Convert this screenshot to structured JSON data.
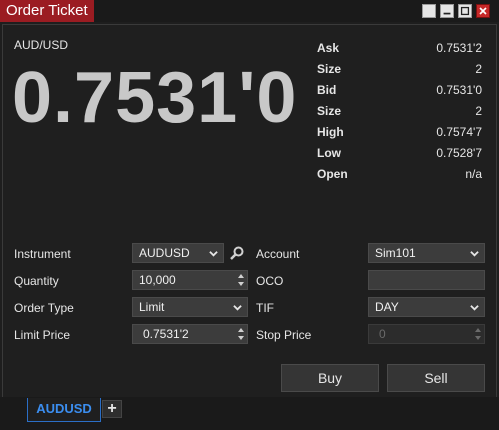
{
  "window": {
    "title": "Order Ticket"
  },
  "quote": {
    "instrument": "AUD/USD",
    "last_price": "0.7531'0",
    "rows": [
      {
        "label": "Ask",
        "value": "0.7531'2"
      },
      {
        "label": "Size",
        "value": "2"
      },
      {
        "label": "Bid",
        "value": "0.7531'0"
      },
      {
        "label": "Size",
        "value": "2"
      },
      {
        "label": "High",
        "value": "0.7574'7"
      },
      {
        "label": "Low",
        "value": "0.7528'7"
      },
      {
        "label": "Open",
        "value": "n/a"
      }
    ]
  },
  "form": {
    "instrument_label": "Instrument",
    "instrument_value": "AUDUSD",
    "account_label": "Account",
    "account_value": "Sim101",
    "quantity_label": "Quantity",
    "quantity_value": "10,000",
    "oco_label": "OCO",
    "oco_value": "",
    "order_type_label": "Order Type",
    "order_type_value": "Limit",
    "tif_label": "TIF",
    "tif_value": "DAY",
    "limit_price_label": "Limit Price",
    "limit_price_value": "0.7531'2",
    "stop_price_label": "Stop Price",
    "stop_price_value": "0"
  },
  "actions": {
    "buy_label": "Buy",
    "sell_label": "Sell"
  },
  "tabs": {
    "active_tab": "AUDUSD",
    "add_label": "+"
  },
  "colors": {
    "title_bg": "#9b1c22",
    "accent": "#3b8ef0",
    "bg": "#1e1e1e"
  },
  "icons": {
    "search": "search-icon",
    "dropdown": "chevron-down-icon",
    "spinner": "spinner-icon",
    "minimize": "minimize-icon",
    "maximize": "maximize-icon",
    "close": "close-icon"
  }
}
